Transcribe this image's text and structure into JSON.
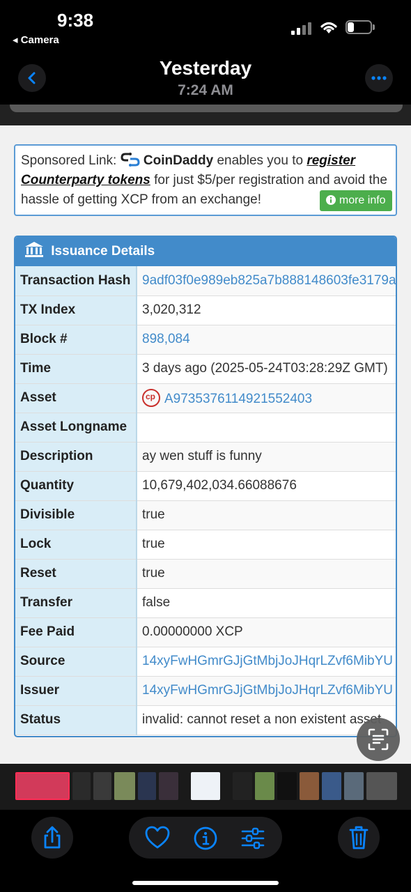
{
  "status_bar": {
    "time": "9:38",
    "back_app": "◂ Camera"
  },
  "photo_nav": {
    "title": "Yesterday",
    "subtitle": "7:24 AM"
  },
  "sponsor": {
    "prefix": "Sponsored Link:",
    "brand": "CoinDaddy",
    "text1": "enables you to",
    "link": "register Counterparty tokens",
    "text2": "for just $5/per registration and avoid the hassle of getting XCP from an exchange!",
    "button": "more info"
  },
  "panel": {
    "title": "Issuance Details",
    "rows": [
      {
        "key": "Transaction Hash",
        "value": "9adf03f0e989eb825a7b888148603fe3179a"
      },
      {
        "key": "TX Index",
        "value": "3,020,312"
      },
      {
        "key": "Block #",
        "value": "898,084"
      },
      {
        "key": "Time",
        "value": "3 days ago (2025-05-24T03:28:29Z GMT)"
      },
      {
        "key": "Asset",
        "value": "A9735376114921552403"
      },
      {
        "key": "Asset Longname",
        "value": ""
      },
      {
        "key": "Description",
        "value": "ay wen stuff is funny"
      },
      {
        "key": "Quantity",
        "value": "10,679,402,034.66088676"
      },
      {
        "key": "Divisible",
        "value": "true"
      },
      {
        "key": "Lock",
        "value": "true"
      },
      {
        "key": "Reset",
        "value": "true"
      },
      {
        "key": "Transfer",
        "value": "false"
      },
      {
        "key": "Fee Paid",
        "value": "0.00000000 XCP"
      },
      {
        "key": "Source",
        "value": "14xyFwHGmrGJjGtMbjJoJHqrLZvf6MibYU"
      },
      {
        "key": "Issuer",
        "value": "14xyFwHGmrGJjGtMbjJoJHqrLZvf6MibYU"
      },
      {
        "key": "Status",
        "value": "invalid: cannot reset a non existent asset"
      }
    ]
  },
  "colors": {
    "accent": "#428bca",
    "key_bg": "#d9edf7",
    "success": "#4cae4c",
    "ios_blue": "#0a84ff"
  },
  "icons": [
    "chevron-left-icon",
    "ellipsis-icon",
    "coindaddy-logo-icon",
    "info-icon",
    "bank-icon",
    "asset-icon",
    "live-text-icon",
    "share-icon",
    "heart-icon",
    "info-circle-icon",
    "adjust-icon",
    "trash-icon"
  ]
}
